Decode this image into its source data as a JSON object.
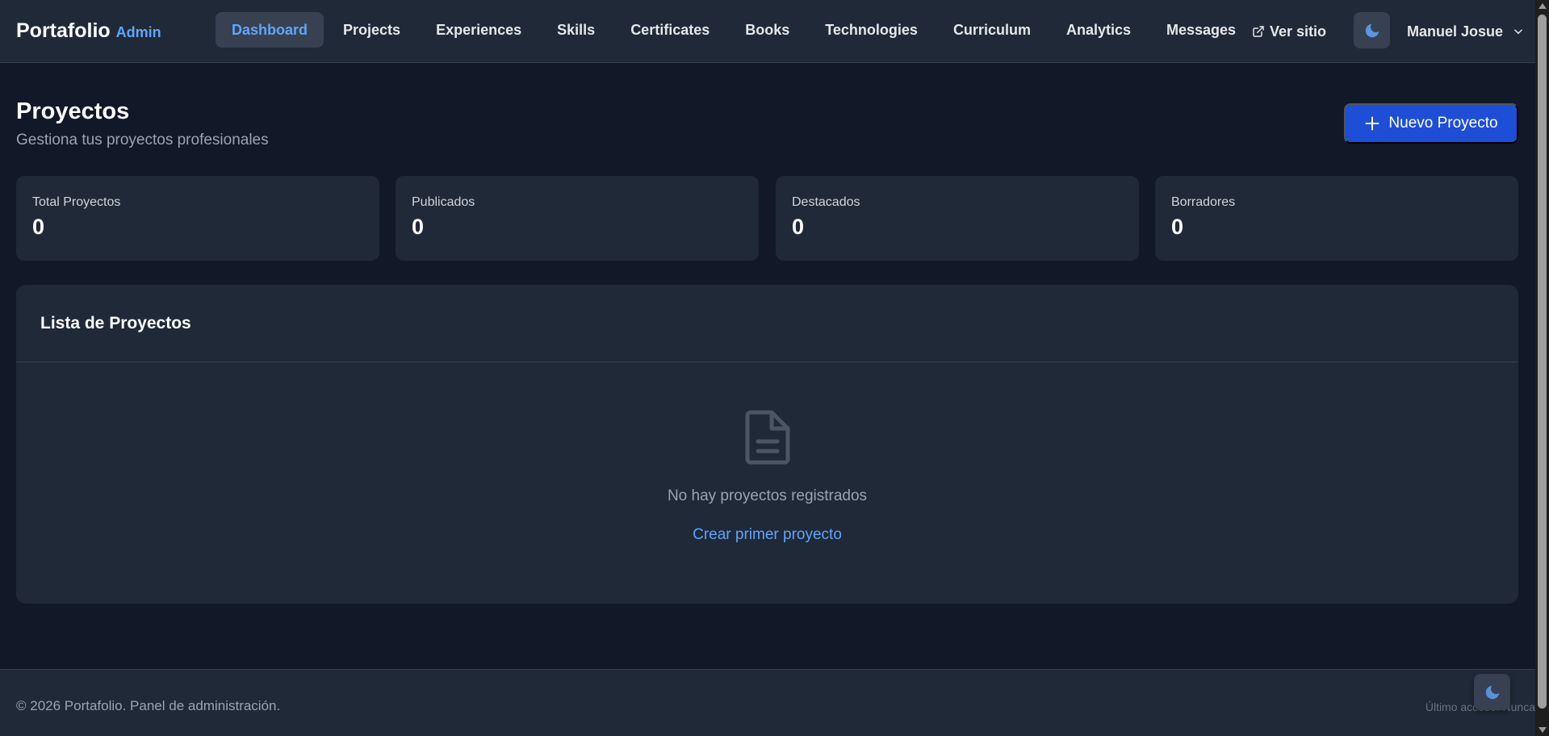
{
  "brand": {
    "name": "Portafolio",
    "sub": "Admin"
  },
  "nav": {
    "items": [
      {
        "label": "Dashboard",
        "active": true
      },
      {
        "label": "Projects"
      },
      {
        "label": "Experiences"
      },
      {
        "label": "Skills"
      },
      {
        "label": "Certificates"
      },
      {
        "label": "Books"
      },
      {
        "label": "Technologies"
      },
      {
        "label": "Curriculum"
      },
      {
        "label": "Analytics"
      },
      {
        "label": "Messages"
      }
    ],
    "view_site_label": "Ver sitio",
    "theme_icon": "moon-icon",
    "user_name": "Manuel Josue"
  },
  "page": {
    "title": "Proyectos",
    "subtitle": "Gestiona tus proyectos profesionales",
    "new_button_label": "Nuevo Proyecto"
  },
  "stats": [
    {
      "label": "Total Proyectos",
      "value": "0"
    },
    {
      "label": "Publicados",
      "value": "0"
    },
    {
      "label": "Destacados",
      "value": "0"
    },
    {
      "label": "Borradores",
      "value": "0"
    }
  ],
  "list": {
    "title": "Lista de Proyectos",
    "empty_icon": "document-icon",
    "empty_text": "No hay proyectos registrados",
    "empty_link": "Crear primer proyecto"
  },
  "footer": {
    "copyright": "© 2026 Portafolio. Panel de administración.",
    "last_access": "Último acceso: Nunca"
  },
  "colors": {
    "page_bg": "#111827",
    "surface": "#1f2937",
    "accent": "#60a5fa",
    "primary_button": "#1d4ed8",
    "muted_text": "#9ca3af"
  }
}
